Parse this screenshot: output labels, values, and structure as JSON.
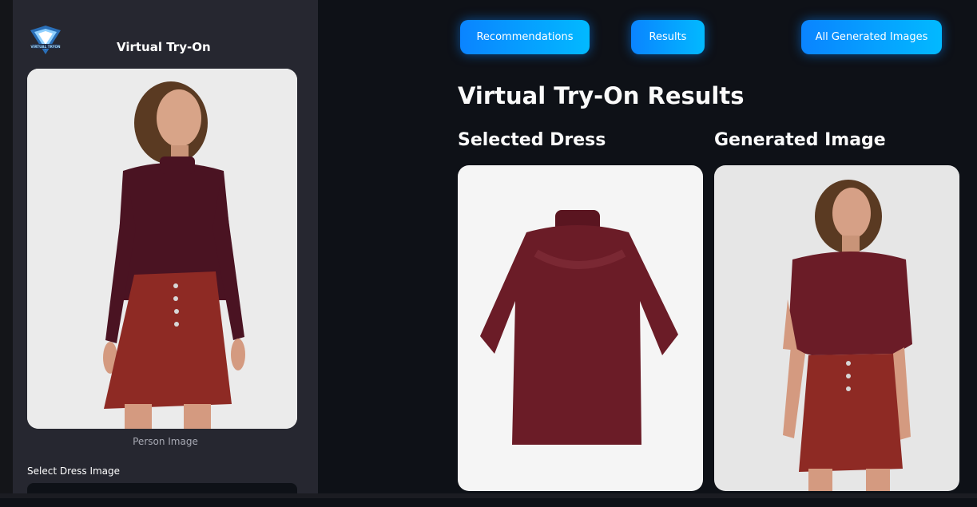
{
  "sidebar": {
    "app_title": "Virtual Try-On",
    "logo_text": "VIRTUAL TRYON",
    "person_caption": "Person Image",
    "select_label": "Select Dress Image"
  },
  "nav": {
    "recommendations": "Recommendations",
    "results": "Results",
    "all_generated": "All Generated Images"
  },
  "main": {
    "heading": "Virtual Try-On Results",
    "selected_dress_heading": "Selected Dress",
    "generated_heading": "Generated Image"
  },
  "colors": {
    "app_bg": "#0e1117",
    "sidebar_bg": "#262730",
    "button_gradient_start": "#0a84ff",
    "button_gradient_end": "#02b9ff",
    "garment_top": "#5a1520",
    "skirt": "#8e2a24"
  }
}
